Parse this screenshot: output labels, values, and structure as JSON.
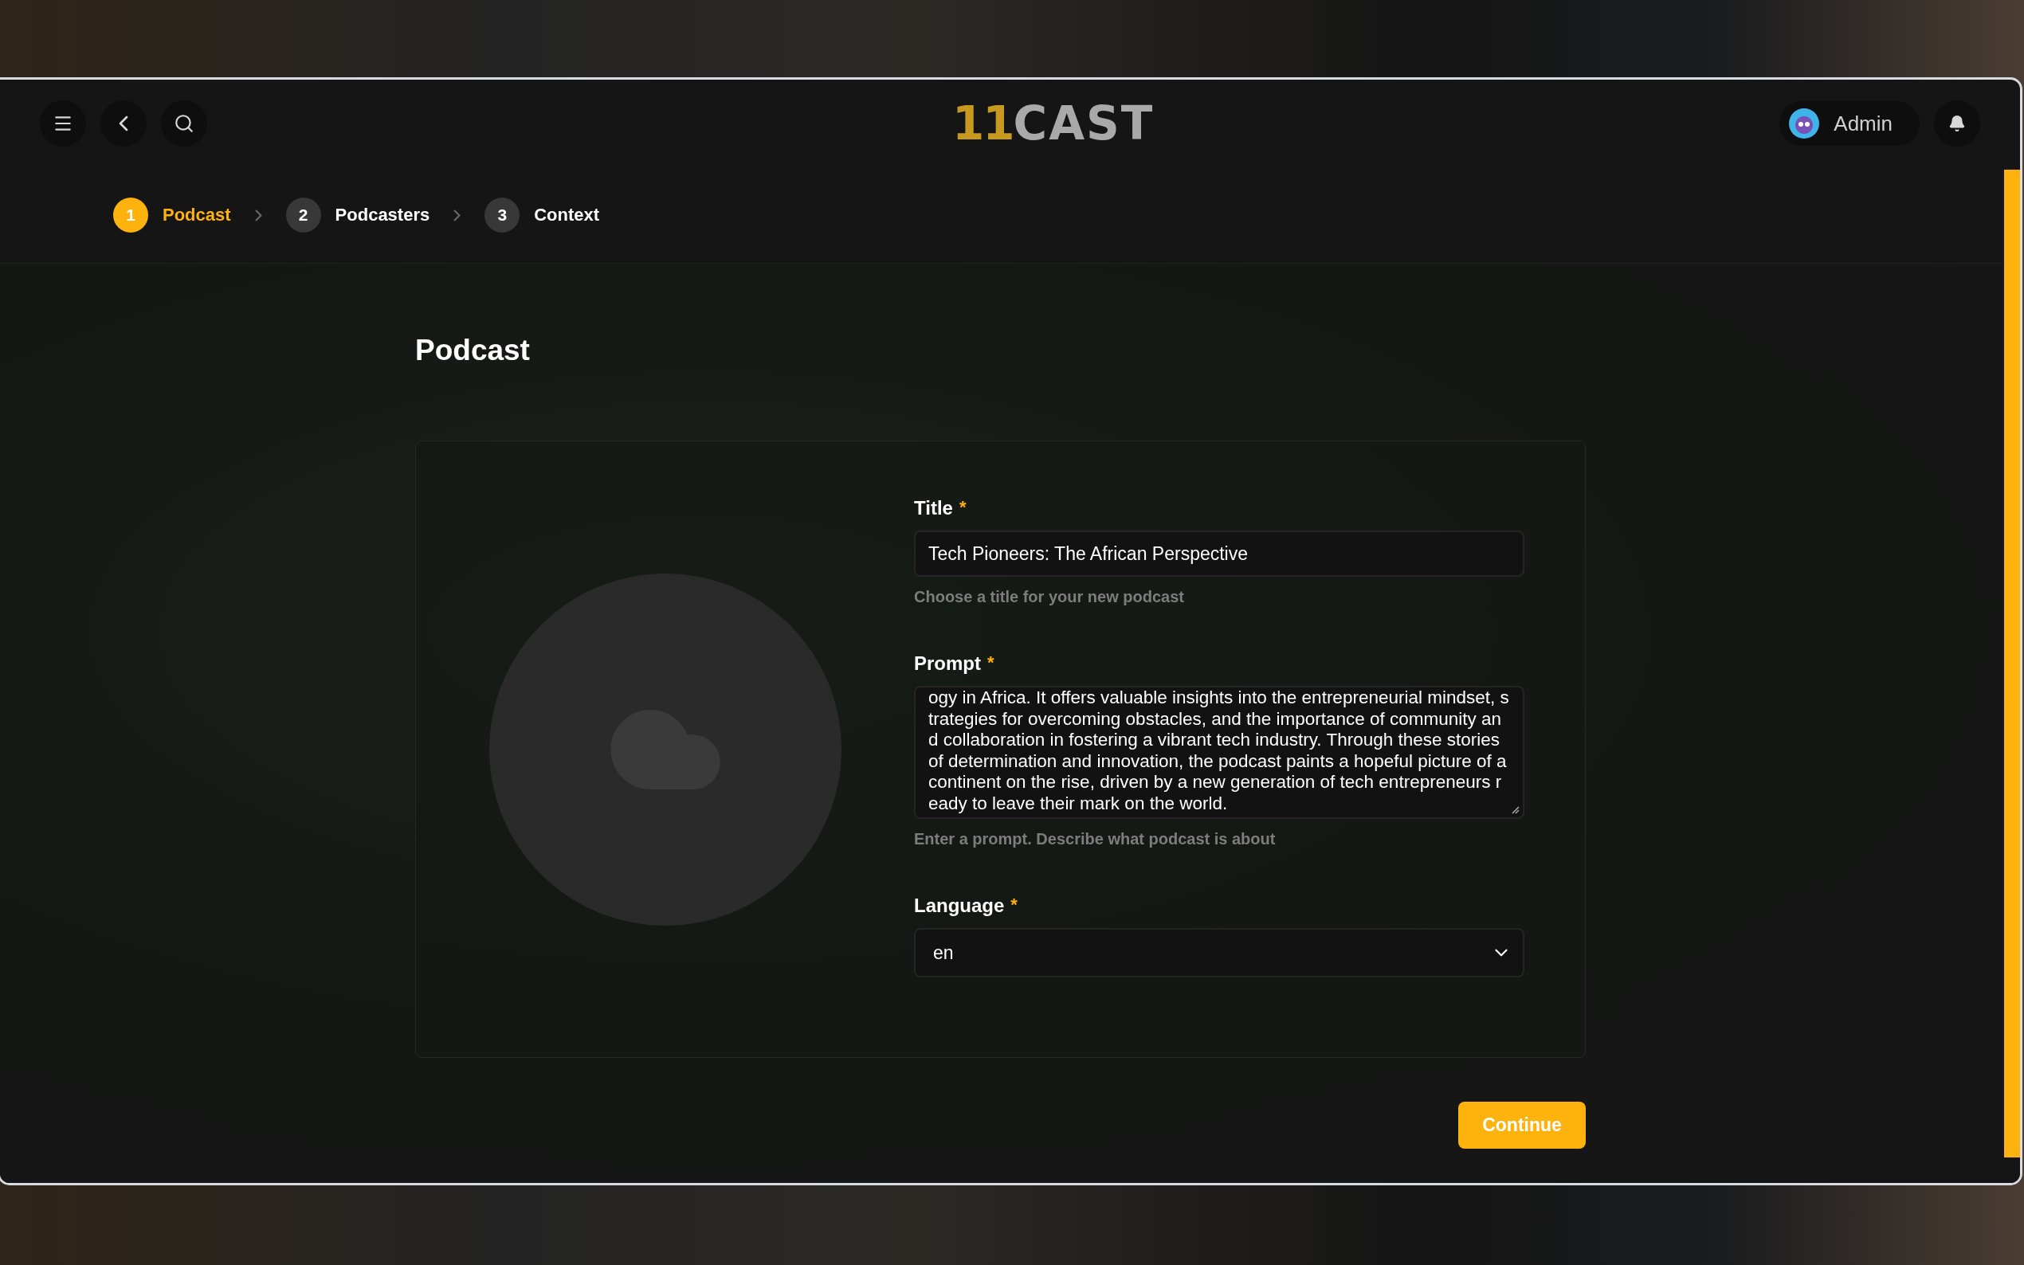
{
  "header": {
    "logo": {
      "digits": "11",
      "word": "CAST"
    },
    "user": {
      "name": "Admin"
    }
  },
  "steps": [
    {
      "number": "1",
      "label": "Podcast",
      "selected": true
    },
    {
      "number": "2",
      "label": "Podcasters",
      "selected": false
    },
    {
      "number": "3",
      "label": "Context",
      "selected": false
    }
  ],
  "page": {
    "title": "Podcast"
  },
  "form": {
    "fields": [
      {
        "kind": "input",
        "label": "Title",
        "required": "*",
        "value": "Tech Pioneers: The African Perspective",
        "hint": "Choose a title for your new podcast"
      },
      {
        "kind": "textarea",
        "label": "Prompt",
        "required": "*",
        "value": "ogy in Africa. It offers valuable insights into the entrepreneurial mindset, strategies for overcoming obstacles, and the importance of community and collaboration in fostering a vibrant tech industry. Through these stories of determination and innovation, the podcast paints a hopeful picture of a continent on the rise, driven by a new generation of tech entrepreneurs ready to leave their mark on the world.",
        "hint": "Enter a prompt. Describe what podcast is about"
      },
      {
        "kind": "select",
        "label": "Language",
        "required": "*",
        "value": "en"
      }
    ]
  },
  "actions": {
    "continue": "Continue"
  }
}
